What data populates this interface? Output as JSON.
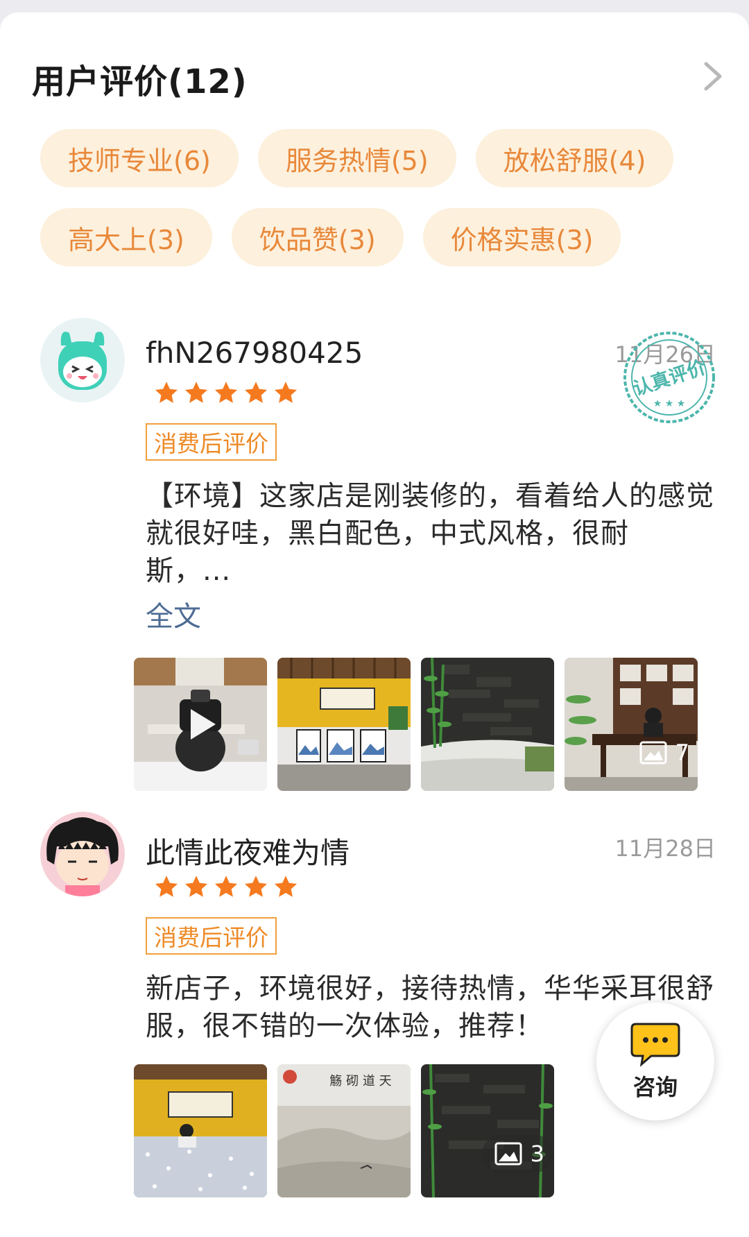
{
  "section": {
    "title": "用户评价(12)"
  },
  "tags": [
    [
      "技师专业(6)",
      "服务热情(5)",
      "放松舒服(4)"
    ],
    [
      "高大上(3)",
      "饮品赞(3)",
      "价格实惠(3)"
    ]
  ],
  "reviews": [
    {
      "username": "fhN267980425",
      "date": "11月26日",
      "rating": 5,
      "badge": "消费后评价",
      "stamp_text": "认真评价",
      "content": "【环境】这家店是刚装修的，看着给人的感觉就很好哇，黑白配色，中式风格，很耐斯，...",
      "fulltext_link": "全文",
      "image_count": "7"
    },
    {
      "username": "此情此夜难为情",
      "date": "11月28日",
      "rating": 5,
      "badge": "消费后评价",
      "content": "新店子，环境很好，接待热情，华华采耳很舒服，很不错的一次体验，推荐！",
      "image_count": "3"
    }
  ],
  "consult_button": {
    "label": "咨询",
    "icon": "chat-bubble-icon"
  },
  "colors": {
    "tag_bg": "#fdf0dc",
    "tag_text": "#e8883a",
    "star": "#f57a1f",
    "badge": "#ee8a26",
    "link": "#4d6c94",
    "stamp": "#4db6ac",
    "consult_icon": "#ffc21a"
  }
}
